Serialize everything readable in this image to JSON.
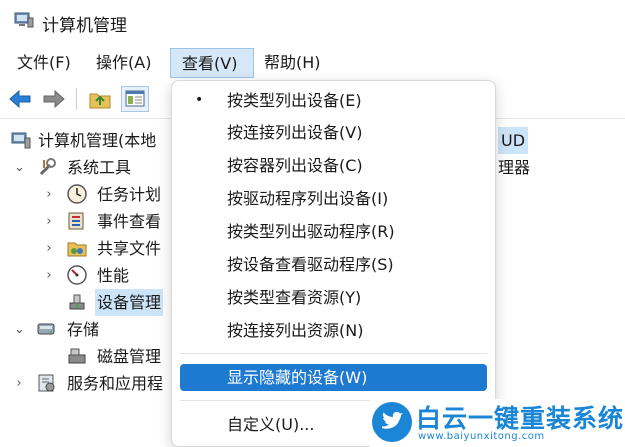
{
  "window": {
    "title": "计算机管理"
  },
  "menubar": {
    "items": [
      {
        "label": "文件(F)"
      },
      {
        "label": "操作(A)"
      },
      {
        "label": "查看(V)"
      },
      {
        "label": "帮助(H)"
      }
    ]
  },
  "toolbar": {
    "buttons": [
      "back-arrow-icon",
      "forward-arrow-icon",
      "up-folder-icon",
      "show-hide-console-tree-icon"
    ]
  },
  "tree": {
    "root": "计算机管理(本地",
    "system_tools": "系统工具",
    "task_scheduler": "任务计划",
    "event_viewer": "事件查看",
    "shared_folders": "共享文件",
    "performance": "性能",
    "device_manager": "设备管理",
    "storage": "存储",
    "disk_management": "磁盘管理",
    "services": "服务和应用程"
  },
  "right_pane": {
    "computer_name_suffix": "UD",
    "device_manager_suffix": "理器"
  },
  "view_menu": {
    "items": [
      {
        "label": "按类型列出设备(E)",
        "checked": true
      },
      {
        "label": "按连接列出设备(V)"
      },
      {
        "label": "按容器列出设备(C)"
      },
      {
        "label": "按驱动程序列出设备(I)"
      },
      {
        "label": "按类型列出驱动程序(R)"
      },
      {
        "label": "按设备查看驱动程序(S)"
      },
      {
        "label": "按类型查看资源(Y)"
      },
      {
        "label": "按连接列出资源(N)"
      },
      {
        "label": "显示隐藏的设备(W)",
        "highlighted": true
      },
      {
        "label": "自定义(U)..."
      }
    ],
    "bullet": "•"
  },
  "watermark": {
    "title": "白云一键重装系统",
    "url": "www.baiyunxitong.com"
  },
  "colors": {
    "menu_highlight": "#1e7ad1",
    "menubar_active": "#d6e8f7",
    "watermark_blue": "#1b86d6"
  }
}
